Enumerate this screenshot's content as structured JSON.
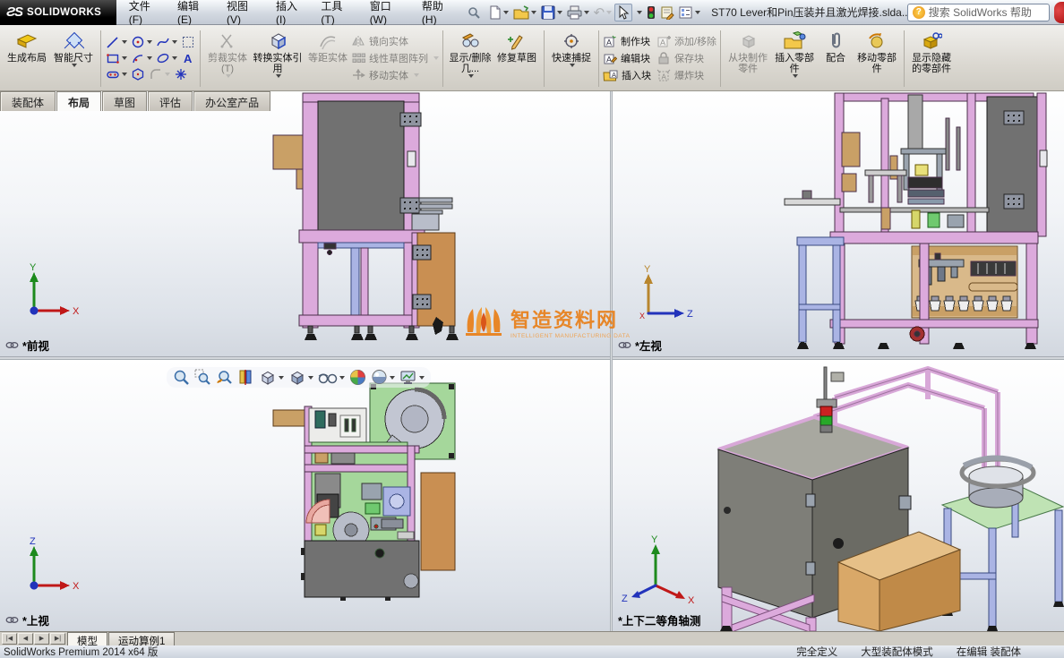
{
  "titlebar": {
    "logo_text": "SOLIDWORKS",
    "menus": [
      "文件(F)",
      "编辑(E)",
      "视图(V)",
      "插入(I)",
      "工具(T)",
      "窗口(W)",
      "帮助(H)"
    ],
    "document_title": "ST70 Lever和Pin压装并且激光焊接.slda...",
    "search_text": "搜索 SolidWorks 帮助"
  },
  "ribbon": {
    "make_layout": "生成布局",
    "smart_dimension": "智能尺寸",
    "trim_entities": "剪裁实体(T)",
    "convert_entities": "转换实体引用",
    "offset_entities": "等距实体",
    "mirror_entities": "镜向实体",
    "linear_sketch_pattern": "线性草图阵列",
    "move_entities": "移动实体",
    "display_delete_relations": "显示/删除几...",
    "repair_sketch": "修复草图",
    "quick_snaps": "快速捕捉",
    "make_block": "制作块",
    "edit_block": "编辑块",
    "insert_block": "插入块",
    "add_remove": "添加/移除",
    "save_block": "保存块",
    "explode_block": "爆炸块",
    "make_part_from_block": "从块制作零件",
    "insert_components": "插入零部件",
    "mate": "配合",
    "move_component": "移动零部件",
    "show_hidden_components": "显示隐藏的零部件"
  },
  "command_tabs": {
    "items": [
      "装配体",
      "布局",
      "草图",
      "评估",
      "办公室产品"
    ],
    "active": "布局"
  },
  "viewports": [
    {
      "label": "*前视",
      "axis_up": "Y",
      "axis_right": "X"
    },
    {
      "label": "*左视",
      "axis_up": "Y",
      "axis_right": "Z"
    },
    {
      "label": "*上视",
      "axis_up": "Z",
      "axis_right": "X"
    },
    {
      "label": "*上下二等角轴测",
      "axis_up": "Y",
      "axis_right": "X",
      "axis_left": "Z"
    }
  ],
  "watermark": {
    "title": "智造资料网",
    "subtitle": "INTELLIGENT MANUFACTURING DATA"
  },
  "motion_bar": {
    "model_tab": "模型",
    "motion_tab": "运动算例1"
  },
  "statusbar": {
    "product": "SolidWorks Premium 2014 x64 版",
    "define_status": "完全定义",
    "mode": "大型装配体模式",
    "editing": "在编辑 装配体"
  },
  "colors": {
    "frame_pink": "#dcaadc",
    "panel_gray": "#717171",
    "brand_orange": "#e8821e",
    "plate_green": "#a5d79b"
  }
}
